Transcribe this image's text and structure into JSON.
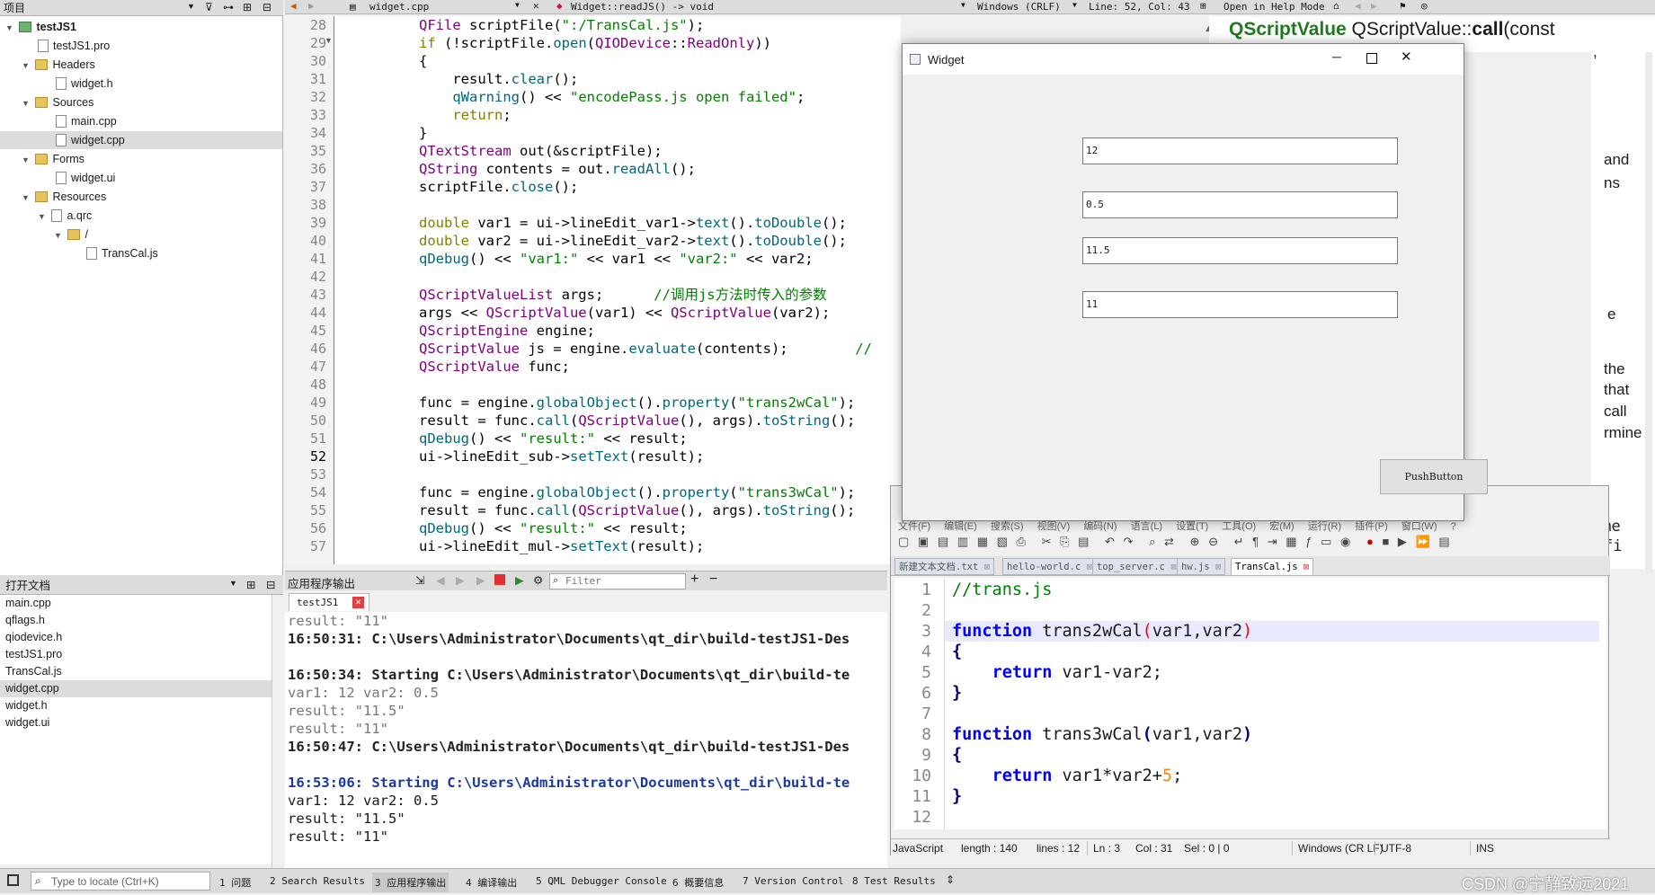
{
  "project_panel": {
    "title": "项目",
    "tree": [
      {
        "label": "testJS1",
        "bold": true
      },
      {
        "label": "testJS1.pro"
      },
      {
        "label": "Headers"
      },
      {
        "label": "widget.h"
      },
      {
        "label": "Sources"
      },
      {
        "label": "main.cpp"
      },
      {
        "label": "widget.cpp"
      },
      {
        "label": "Forms"
      },
      {
        "label": "widget.ui"
      },
      {
        "label": "Resources"
      },
      {
        "label": "a.qrc"
      },
      {
        "label": "/"
      },
      {
        "label": "TransCal.js"
      }
    ]
  },
  "open_docs": {
    "title": "打开文档",
    "items": [
      "main.cpp",
      "qflags.h",
      "qiodevice.h",
      "testJS1.pro",
      "TransCal.js",
      "widget.cpp",
      "widget.h",
      "widget.ui"
    ]
  },
  "editor": {
    "file": "widget.cpp",
    "function": "Widget::readJS() -> void",
    "line_ending": "Windows (CRLF)",
    "position": "Line: 52, Col: 43",
    "help_mode": "Open in Help Mode",
    "lines": [
      "28",
      "29",
      "30",
      "31",
      "32",
      "33",
      "34",
      "35",
      "36",
      "37",
      "38",
      "39",
      "40",
      "41",
      "42",
      "43",
      "44",
      "45",
      "46",
      "47",
      "48",
      "49",
      "50",
      "51",
      "52",
      "53",
      "54",
      "55",
      "56",
      "57"
    ]
  },
  "help": {
    "heading_class": "QScriptValue",
    "heading_sep": " QScriptValue::",
    "heading_method": "call",
    "heading_tail": "(const",
    "fragments": [
      ",",
      "and",
      "ns",
      "e",
      "the",
      "that",
      "call",
      "rmine",
      "ame",
      "fi"
    ]
  },
  "output": {
    "title": "应用程序输出",
    "filter_placeholder": "Filter",
    "tab": "testJS1",
    "lines": [
      "result: \"11\"",
      "16:50:31: C:\\Users\\Administrator\\Documents\\qt_dir\\build-testJS1-Des",
      "",
      "16:50:34: Starting C:\\Users\\Administrator\\Documents\\qt_dir\\build-te",
      "var1: 12 var2: 0.5",
      "result: \"11.5\"",
      "result: \"11\"",
      "16:50:47: C:\\Users\\Administrator\\Documents\\qt_dir\\build-testJS1-Des",
      "",
      "16:53:06: Starting C:\\Users\\Administrator\\Documents\\qt_dir\\build-te",
      "var1: 12 var2: 0.5",
      "result: \"11.5\"",
      "result: \"11\""
    ]
  },
  "status_bar": {
    "locate_placeholder": "Type to locate (Ctrl+K)",
    "tabs": [
      "1 问题",
      "2 Search Results",
      "3 应用程序输出",
      "4 编译输出",
      "5 QML Debugger Console",
      "6 概要信息",
      "7 Version Control",
      "8 Test Results"
    ],
    "watermark": "CSDN @宁静致远2021"
  },
  "widget_window": {
    "title": "Widget",
    "line_edits": [
      "12",
      "0.5",
      "11.5",
      "11"
    ],
    "button": "PushButton"
  },
  "npp": {
    "menu": [
      "文件(F)",
      "编辑(E)",
      "搜索(S)",
      "视图(V)",
      "编码(N)",
      "语言(L)",
      "设置(T)",
      "工具(O)",
      "宏(M)",
      "运行(R)",
      "插件(P)",
      "窗口(W)",
      "?"
    ],
    "tabs": [
      "新建文本文档.txt",
      "hello-world.c",
      "top_server.c",
      "hw.js",
      "TransCal.js"
    ],
    "lines": [
      "1",
      "2",
      "3",
      "4",
      "5",
      "6",
      "7",
      "8",
      "9",
      "10",
      "11",
      "12"
    ],
    "code": {
      "l1": "//trans.js",
      "fn_kw": "function",
      "fn2_name": " trans2wCal",
      "fn3_name": " trans3wCal",
      "params": "var1,var2",
      "ret_kw": "return",
      "ret2": " var1-var2;",
      "ret3_a": " var1*var2+",
      "ret3_num": "5",
      "ret3_end": ";"
    },
    "status": {
      "type": "JavaScript",
      "length": "length : 140",
      "lines": "lines : 12",
      "ln": "Ln : 3",
      "col": "Col : 31",
      "sel": "Sel : 0 | 0",
      "eol": "Windows (CR LF)",
      "enc": "UTF-8",
      "mode": "INS"
    }
  }
}
